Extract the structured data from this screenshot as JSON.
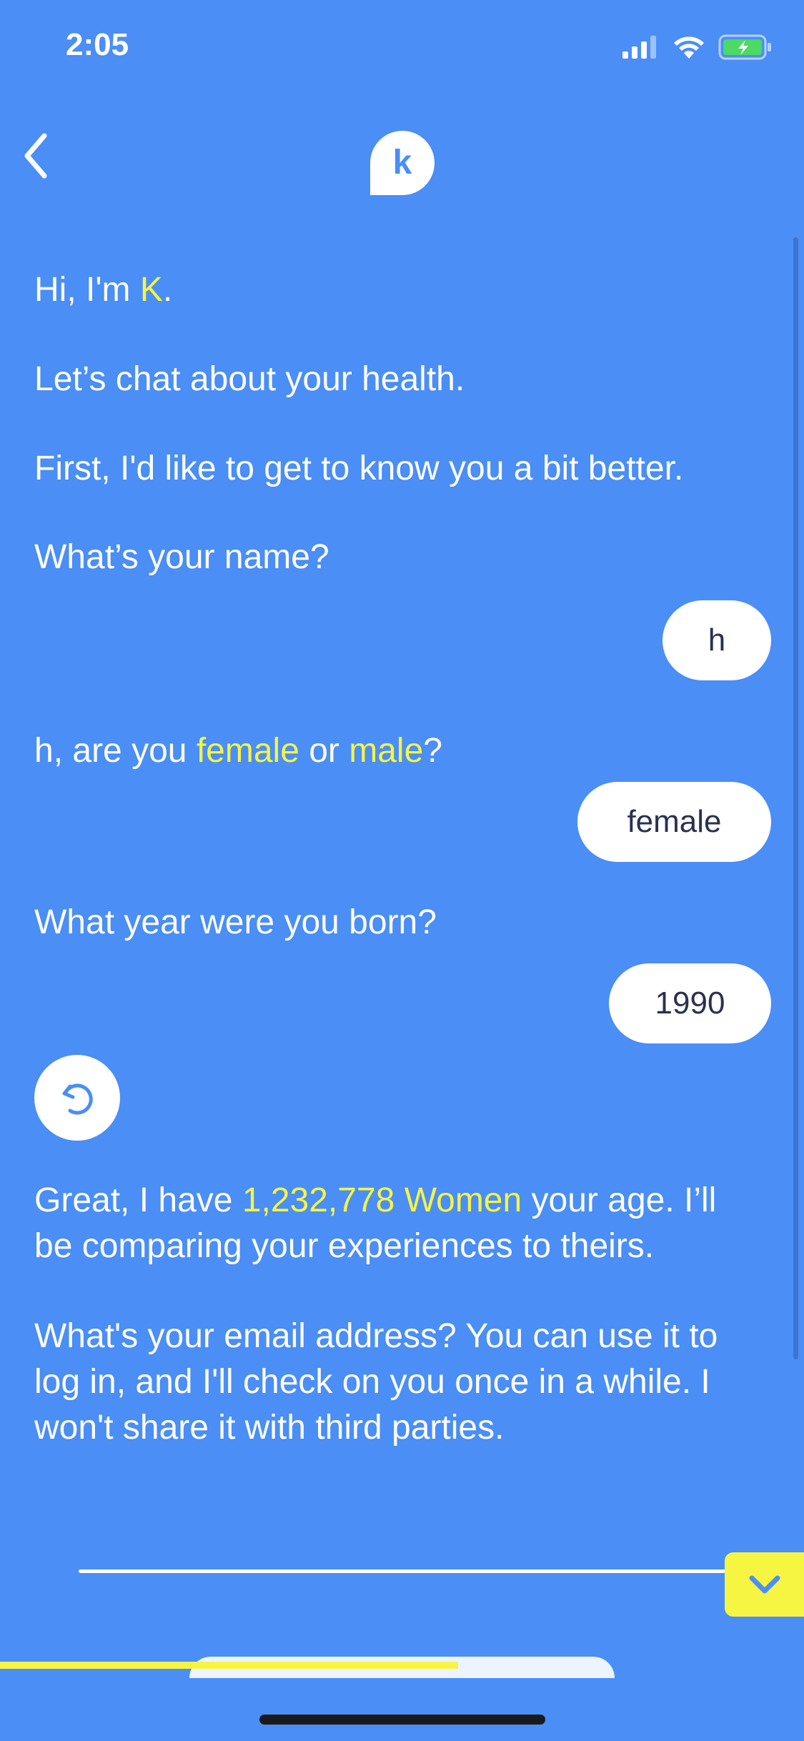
{
  "status_bar": {
    "time": "2:05"
  },
  "header": {
    "logo_letter": "k"
  },
  "conversation": {
    "greeting_prefix": "Hi, I'm ",
    "greeting_name": "K",
    "greeting_suffix": ".",
    "intro": "Let’s chat about your health.",
    "know_you": "First, I'd like to get to know you a bit better.",
    "ask_name": "What’s your name?",
    "reply_name": "h",
    "gender_prefix": "h, are you ",
    "gender_option_female": "female",
    "gender_or": " or ",
    "gender_option_male": "male",
    "gender_suffix": "?",
    "reply_gender": "female",
    "ask_year": "What year were you born?",
    "reply_year": "1990",
    "compare_prefix": "Great, I have ",
    "compare_count": "1,232,778 Women",
    "compare_suffix": " your age. I’ll be comparing your experiences to theirs.",
    "ask_email": "What's your email address? You can use it to log in, and I'll check on you once in a while. I won't share it with third parties."
  },
  "progress": {
    "fraction": 0.57
  },
  "colors": {
    "background": "#4a8ef6",
    "accent": "#f5f542",
    "reply_text": "#2a3150"
  }
}
